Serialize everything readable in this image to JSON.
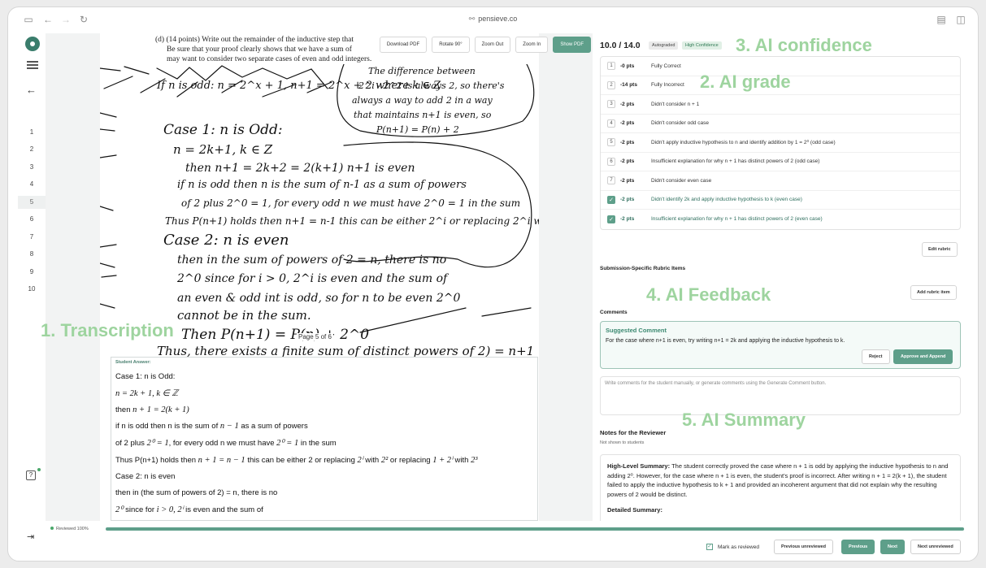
{
  "browser": {
    "url": "pensieve.co"
  },
  "nav": {
    "pages": [
      "1",
      "2",
      "3",
      "4",
      "5",
      "6",
      "7",
      "8",
      "9",
      "10"
    ],
    "active_page": "5"
  },
  "viewer": {
    "toolbar": {
      "download": "Download PDF",
      "rotate": "Rotate 90°",
      "zoom_out": "Zoom Out",
      "zoom_in": "Zoom In",
      "show_pdf": "Show PDF"
    },
    "question_line1": "(d)  (14 points)  Write out the remainder of the inductive step that",
    "question_line2": "Be sure that your proof clearly shows that we have a sum of",
    "question_line3": "may want to consider two separate cases of even and odd integers.",
    "page_label": "Page 5 of 6",
    "handwriting": [
      "If n is odd: n = 2^x + 1, n+1 = 2^x + 2  where k ∈ Z",
      "Case 1: n is Odd:",
      "n = 2k+1, k ∈ Z",
      "then n+1 = 2k+2 = 2(k+1)   n+1 is even",
      "if n is odd then n is the sum of n-1 as a sum of powers",
      "of 2 plus 2^0 = 1, for every odd n we must have 2^0 = 1 in the sum",
      "Thus P(n+1) holds   then n+1 = n-1  this can be either 2^i or replacing 2^i with 2^2",
      "Case 2: n is even",
      "then in the sum of powers of 2 = n, there is no",
      "2^0 since for i > 0, 2^i is even and the sum of",
      "an even & odd int is odd, so for n to be even 2^0",
      "cannot be in the sum.",
      "Then P(n+1) = P(n) + 2^0",
      "Thus, there exists a finite sum of distinct powers of 2) = n+1"
    ],
    "margin_notes": [
      "The difference between",
      "2^i - 2^2 is always 2, so there's",
      "always a way to add 2 in a way",
      "that maintains n+1 is even, so",
      "P(n+1) = P(n) + 2"
    ],
    "transcription": {
      "label": "Student Answer:",
      "lines": [
        [
          "Case 1: n is Odd:"
        ],
        [
          "",
          "n = 2k + 1, k ∈ ℤ"
        ],
        [
          "then ",
          "n + 1 = 2(k + 1)"
        ],
        [
          "if n is odd then n is the sum of ",
          "n − 1",
          " as a sum of powers"
        ],
        [
          "of 2 plus ",
          "2⁰ = 1",
          ", for every odd n we must have ",
          "2⁰ = 1",
          " in the sum"
        ],
        [
          "Thus P(n+1) holds then ",
          "n + 1 = n − 1",
          " this can be either 2 or replacing ",
          "2ⁱ",
          " with ",
          "2²",
          " or replacing ",
          "1 + 2ⁱ",
          " with ",
          "2³"
        ],
        [
          "Case 2: n is even"
        ],
        [
          "then in (the sum of powers of 2) = n, there is no"
        ],
        [
          "",
          "2⁰",
          " since for ",
          "i > 0, 2ⁱ",
          " is even and the sum of"
        ]
      ]
    }
  },
  "overlays": {
    "transcription": "1. Transcription",
    "grade": "2. AI grade",
    "confidence": "3. AI confidence",
    "feedback": "4. AI Feedback",
    "summary": "5. AI Summary"
  },
  "grading": {
    "score": "10.0 / 14.0",
    "badge_auto": "Autograded",
    "badge_conf": "High Confidence",
    "rubric": [
      {
        "num": "1",
        "pts": "-0 pts",
        "desc": "Fully Correct",
        "checked": false
      },
      {
        "num": "2",
        "pts": "-14 pts",
        "desc": "Fully Incorrect",
        "checked": false
      },
      {
        "num": "3",
        "pts": "-2 pts",
        "desc": "Didn't consider n + 1",
        "checked": false
      },
      {
        "num": "4",
        "pts": "-2 pts",
        "desc": "Didn't consider odd case",
        "checked": false
      },
      {
        "num": "5",
        "pts": "-2 pts",
        "desc": "Didn't apply inductive hypothesis to n and identify addition by 1 = 2⁰ (odd case)",
        "checked": false
      },
      {
        "num": "6",
        "pts": "-2 pts",
        "desc": "Insufficient explanation for why n + 1 has distinct powers of 2 (odd case)",
        "checked": false
      },
      {
        "num": "7",
        "pts": "-2 pts",
        "desc": "Didn't consider even case",
        "checked": false
      },
      {
        "num": "8",
        "pts": "-2 pts",
        "desc": "Didn't identify 2k and apply inductive hypothesis to k (even case)",
        "checked": true
      },
      {
        "num": "9",
        "pts": "-2 pts",
        "desc": "Insufficient explanation for why n + 1 has distinct powers of 2 (even case)",
        "checked": true
      }
    ],
    "edit_rubric": "Edit rubric",
    "submission_specific": "Submission-Specific Rubric Items",
    "add_rubric_item": "Add rubric item",
    "comments_title": "Comments",
    "suggested_title": "Suggested Comment",
    "suggested_body": "For the case where n+1 is even, try writing n+1 = 2k and applying the inductive hypothesis to k.",
    "reject": "Reject",
    "approve": "Approve and Append",
    "comment_placeholder": "Write comments for the student manually, or generate comments using the Generate Comment button.",
    "notes_title": "Notes for the Reviewer",
    "notes_sub": "Not shown to students",
    "summary_head": "High-Level Summary:",
    "summary_body": "The student correctly proved the case where n + 1 is odd by applying the inductive hypothesis to n and adding 2⁰. However, for the case where n + 1 is even, the student's proof is incorrect. After writing n + 1 = 2(k + 1), the student failed to apply the inductive hypothesis to k + 1 and provided an incoherent argument that did not explain why the resulting powers of 2 would be distinct.",
    "detailed_head": "Detailed Summary:"
  },
  "footer": {
    "progress_label": "Reviewed 100%",
    "progress": 1.0,
    "mark_reviewed": "Mark as reviewed",
    "prev_unreviewed": "Previous unreviewed",
    "previous": "Previous",
    "next": "Next",
    "next_unreviewed": "Next unreviewed"
  }
}
